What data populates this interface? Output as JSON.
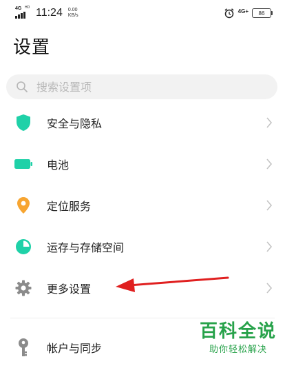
{
  "status_bar": {
    "network_left": "4G",
    "network_left_badge": "HD",
    "time": "11:24",
    "speed_value": "0.00",
    "speed_unit": "KB/s",
    "network_right": "4G",
    "network_right_badge": "+",
    "battery": "86"
  },
  "page": {
    "title": "设置"
  },
  "search": {
    "placeholder": "搜索设置项"
  },
  "items": [
    {
      "label": "安全与隐私",
      "icon": "shield-icon",
      "color": "#1fd1a8"
    },
    {
      "label": "电池",
      "icon": "battery-icon",
      "color": "#1fd1a8"
    },
    {
      "label": "定位服务",
      "icon": "location-pin-icon",
      "color": "#f7a531"
    },
    {
      "label": "运存与存储空间",
      "icon": "storage-pie-icon",
      "color": "#1fd1a8"
    },
    {
      "label": "更多设置",
      "icon": "gear-icon",
      "color": "#8b8b8b"
    },
    {
      "label": "帐户与同步",
      "icon": "key-icon",
      "color": "#8b8b8b"
    }
  ],
  "annotation": {
    "arrow_color": "#e02020"
  },
  "watermark": {
    "title": "百科全说",
    "subtitle": "助你轻松解决"
  }
}
